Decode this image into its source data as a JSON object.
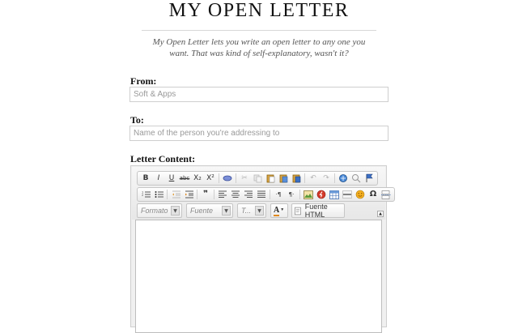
{
  "header": {
    "title": "MY OPEN LETTER",
    "subtitle": "My Open Letter lets you write an open letter to any one you want. That was kind of self-explanatory, wasn't it?"
  },
  "form": {
    "from_label": "From:",
    "from_value": "Soft & Apps",
    "to_label": "To:",
    "to_placeholder": "Name of the person you're addressing to",
    "content_label": "Letter Content:"
  },
  "editor": {
    "toolbar_row1": [
      "B",
      "I",
      "U",
      "abc",
      "X₂",
      "X²",
      "eraser",
      "cut",
      "copy",
      "paste",
      "paste-text",
      "paste-word",
      "undo",
      "redo",
      "find",
      "replace",
      "flag"
    ],
    "toolbar_row2": [
      "numbered-list",
      "bulleted-list",
      "outdent",
      "indent",
      "blockquote",
      "align-left",
      "align-center",
      "align-right",
      "justify",
      "ltr",
      "rtl",
      "image",
      "flash",
      "table",
      "horizontal-line",
      "smiley",
      "Ω",
      "page-break"
    ],
    "format_label": "Formato",
    "font_label": "Fuente",
    "size_label": "T...",
    "text_color_label": "A",
    "source_label": "Fuente HTML",
    "body_value": ""
  }
}
